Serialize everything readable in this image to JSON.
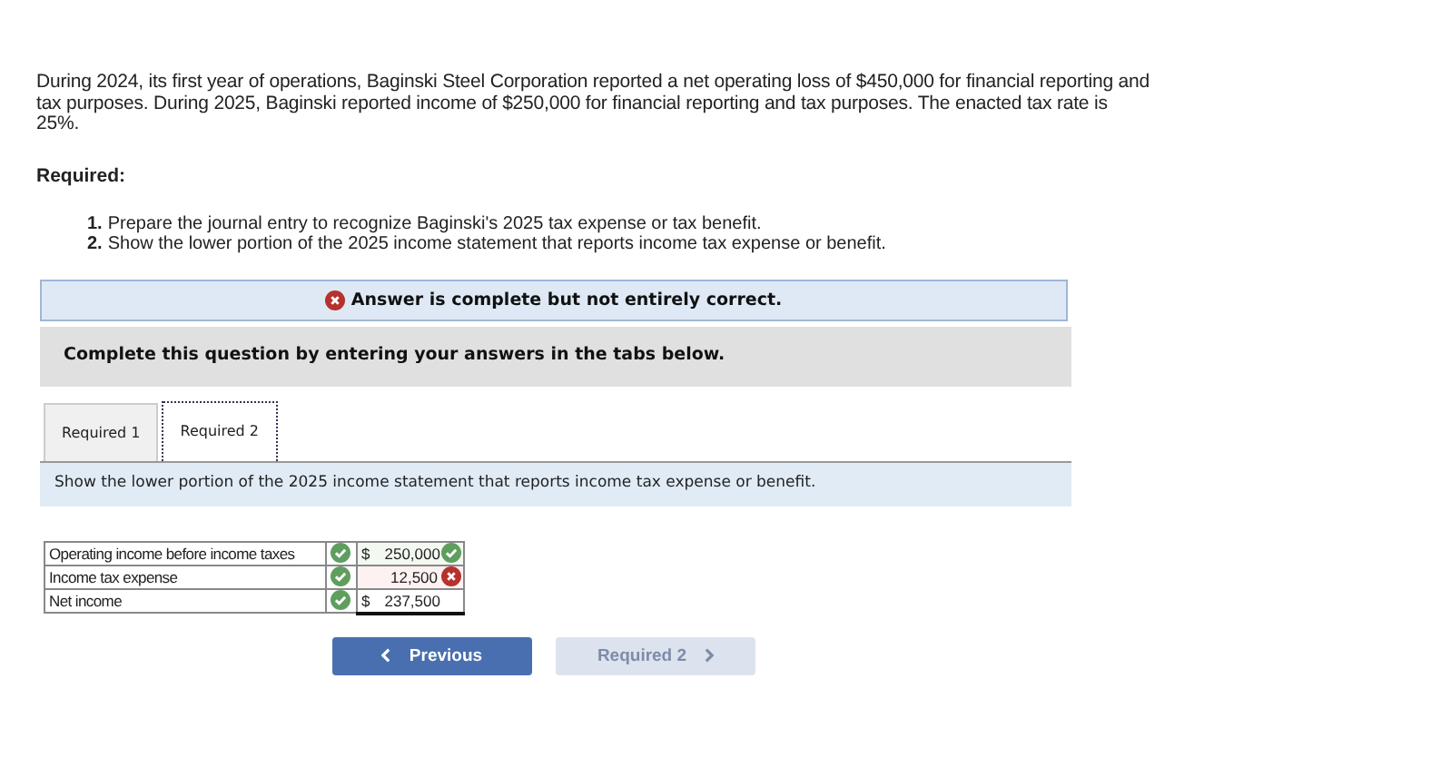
{
  "intro": "During 2024, its first year of operations, Baginski Steel Corporation reported a net operating loss of $450,000 for financial reporting and tax purposes. During 2025, Baginski reported income of $250,000 for financial reporting and tax purposes. The enacted tax rate is 25%.",
  "required_heading": "Required:",
  "requirements": [
    {
      "number": "1.",
      "text": "Prepare the journal entry to recognize Baginski's 2025 tax expense or tax benefit."
    },
    {
      "number": "2.",
      "text": "Show the lower portion of the 2025 income statement that reports income tax expense or benefit."
    }
  ],
  "result_banner": {
    "correct": false,
    "text": "Answer is complete but not entirely correct."
  },
  "instruction": "Complete this question by entering your answers in the tabs below.",
  "tabs": [
    {
      "label": "Required 1",
      "selected": false
    },
    {
      "label": "Required 2",
      "selected": true
    }
  ],
  "tab_prompt": "Show the lower portion of the 2025 income statement that reports income tax expense or benefit.",
  "rows": [
    {
      "label": "Operating income before income taxes",
      "label_correct": true,
      "currency": "$",
      "amount": "250,000",
      "value_correct": true
    },
    {
      "label": "Income tax expense",
      "label_correct": true,
      "amount": "12,500",
      "value_correct": false
    },
    {
      "label": "Net income",
      "label_correct": true,
      "currency": "$",
      "amount": "237,500",
      "total": true
    }
  ],
  "buttons": [
    {
      "label": "Previous",
      "kind": "back",
      "disabled": false
    },
    {
      "label": "Required 2",
      "kind": "next",
      "disabled": true
    }
  ]
}
